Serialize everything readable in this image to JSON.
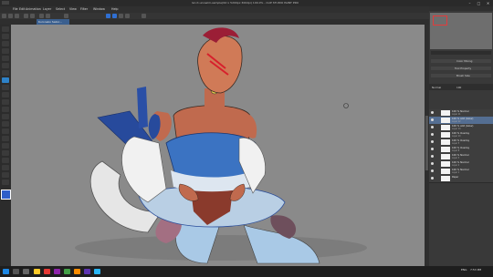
{
  "window": {
    "title": "lan it-unrealm-sample(Ilkl x 5200px 300dpi) 100.0%  - CLIP STUDIO PAINT PRO"
  },
  "menu": [
    "File",
    "Edit",
    "Animation",
    "Layer",
    "Select",
    "View",
    "Filter",
    "Window",
    "Help"
  ],
  "document_tab": "Kuroneko Sailor...",
  "right_panel": {
    "header": "",
    "rows": [
      "Color Mixing",
      "Tool Property",
      "Brush Size"
    ],
    "layer_props": [
      "Normal",
      "100"
    ]
  },
  "layers": [
    {
      "name": "100 % Normal",
      "sub": "Layer 11",
      "selected": false
    },
    {
      "name": "100 % Add (Glow)",
      "sub": "Layer 12",
      "selected": true
    },
    {
      "name": "100 % Add (Glow)",
      "sub": "Layer 14",
      "selected": false
    },
    {
      "name": "100 % Overlay",
      "sub": "Layer 10",
      "selected": false
    },
    {
      "name": "100 % Overlay",
      "sub": "Layer 5",
      "selected": false
    },
    {
      "name": "100 % Overlay",
      "sub": "Layer 8",
      "selected": false
    },
    {
      "name": "100 % Normal",
      "sub": "Layer 3",
      "selected": false
    },
    {
      "name": "100 % Normal",
      "sub": "Layer 2",
      "selected": false
    },
    {
      "name": "100 % Normal",
      "sub": "Layer 1",
      "selected": false
    },
    {
      "name": "Paper",
      "sub": "",
      "selected": false
    }
  ],
  "taskbar": {
    "time": "7:53 PM",
    "date": "",
    "lang": "ENG"
  },
  "colors": {
    "accent": "#2f6fd2",
    "selected_layer": "#546e92",
    "current_color": "#2f5ec9"
  },
  "icons": {
    "nav": "navigator-thumbnail",
    "eye": "eye-icon",
    "folder": "folder-icon"
  }
}
